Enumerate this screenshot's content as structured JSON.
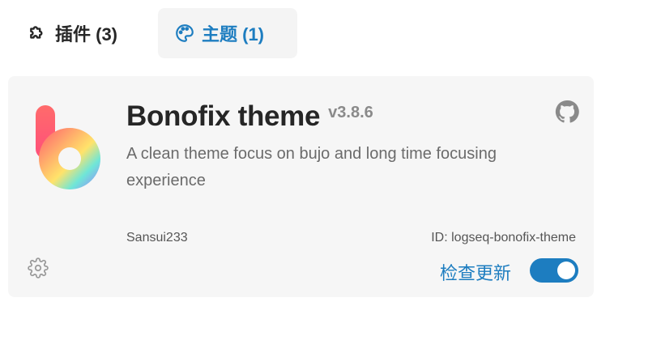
{
  "tabs": [
    {
      "label": "插件 (3)",
      "icon": "puzzle-icon",
      "active": false
    },
    {
      "label": "主题 (1)",
      "icon": "palette-icon",
      "active": true
    }
  ],
  "theme_card": {
    "title": "Bonofix theme",
    "version": "v3.8.6",
    "description": "A clean theme focus on bujo and long time focusing experience",
    "author": "Sansui233",
    "id_label": "ID: logseq-bonofix-theme",
    "check_update_label": "检查更新",
    "enabled": true
  },
  "colors": {
    "accent": "#1d7dc0",
    "card_bg": "#f6f6f6",
    "active_tab_bg": "#f4f4f4"
  }
}
